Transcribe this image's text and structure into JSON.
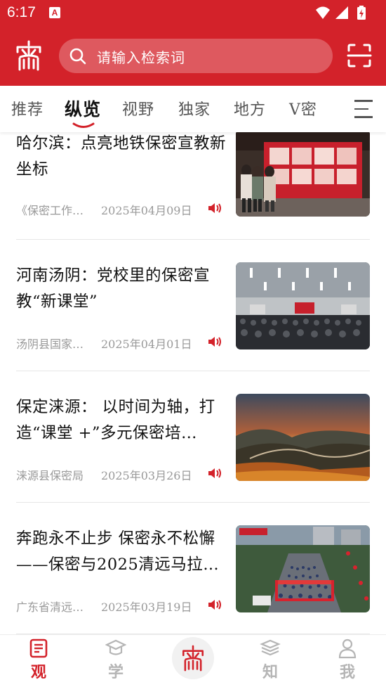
{
  "status_bar": {
    "time": "6:17",
    "notification_icon": "a-badge-icon",
    "icons": [
      "wifi-icon",
      "signal-icon",
      "battery-charging-icon"
    ]
  },
  "header": {
    "logo_icon": "baomi-seal-logo",
    "search": {
      "placeholder": "请输入检索词"
    },
    "scan_icon": "scan-icon",
    "colors": {
      "brand": "#d3222a"
    }
  },
  "tabs": [
    {
      "label": "推荐",
      "active": false
    },
    {
      "label": "纵览",
      "active": true
    },
    {
      "label": "视野",
      "active": false
    },
    {
      "label": "独家",
      "active": false
    },
    {
      "label": "地方",
      "active": false
    },
    {
      "label": "V密",
      "active": false
    }
  ],
  "news": [
    {
      "title": "哈尔滨：点亮地铁保密宣教新坐标",
      "source": "《保密工作…",
      "date": "2025年04月09日",
      "thumb": "subway-exhibition-photo"
    },
    {
      "title": "河南汤阴：党校里的保密宣教“新课堂”",
      "source": "汤阴县国家…",
      "date": "2025年04月01日",
      "thumb": "lecture-hall-photo"
    },
    {
      "title": "保定涞源： 以时间为轴，打造“课堂 +”多元保密培…",
      "source": "涞源县保密局",
      "date": "2025年03月26日",
      "thumb": "great-wall-sunset-photo"
    },
    {
      "title": "奔跑永不止步 保密永不松懈——保密与2025清远马拉…",
      "source": "广东省清远…",
      "date": "2025年03月19日",
      "thumb": "marathon-start-photo"
    }
  ],
  "bottom_nav": [
    {
      "label": "观",
      "icon": "article-icon",
      "active": true
    },
    {
      "label": "学",
      "icon": "graduation-cap-icon",
      "active": false
    },
    {
      "label": "",
      "icon": "baomi-seal-logo",
      "active": false
    },
    {
      "label": "知",
      "icon": "books-icon",
      "active": false
    },
    {
      "label": "我",
      "icon": "user-icon",
      "active": false
    }
  ]
}
